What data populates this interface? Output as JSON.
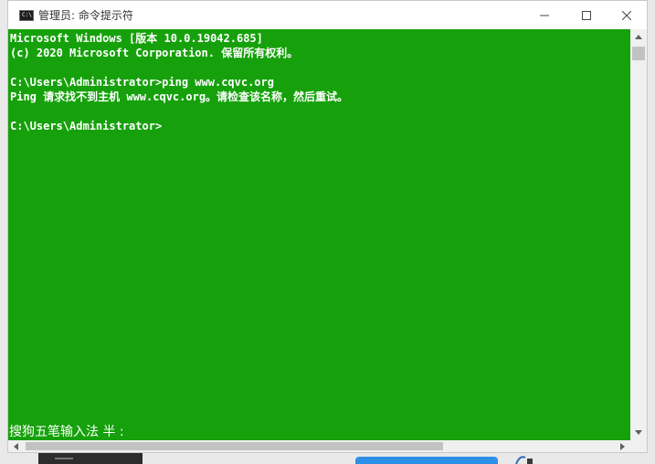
{
  "window": {
    "title": "管理员: 命令提示符",
    "icon": "cmd-icon",
    "buttons": {
      "minimize": "minimize-icon",
      "maximize": "maximize-icon",
      "close": "close-icon"
    }
  },
  "console": {
    "background_color": "#16a10c",
    "text_color": "#ffffff",
    "lines": [
      "Microsoft Windows [版本 10.0.19042.685]",
      "(c) 2020 Microsoft Corporation. 保留所有权利。",
      "",
      "C:\\Users\\Administrator>ping www.cqvc.org",
      "Ping 请求找不到主机 www.cqvc.org。请检查该名称，然后重试。",
      "",
      "C:\\Users\\Administrator>"
    ]
  },
  "ime": {
    "status": "搜狗五笔输入法 半 :"
  },
  "scrollbars": {
    "vertical": "vertical-scrollbar",
    "horizontal": "horizontal-scrollbar"
  }
}
